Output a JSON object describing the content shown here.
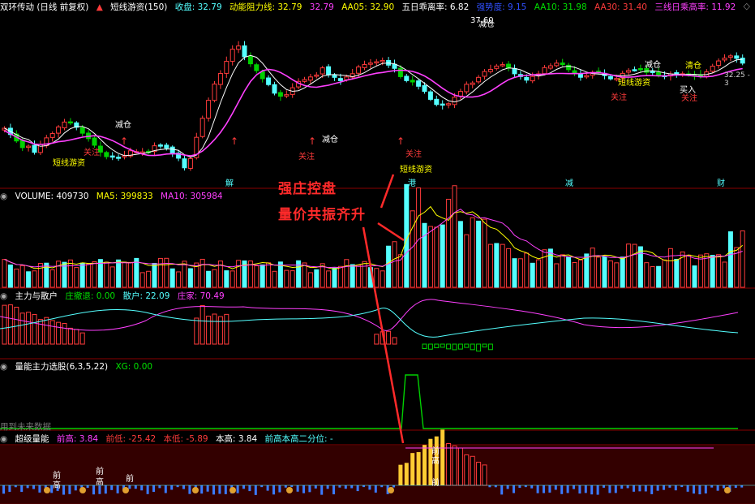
{
  "colors": {
    "up": "#ff3b3b",
    "down": "#54ffff",
    "green": "#00d000",
    "ma": "#ff40ff",
    "white": "#ffffff",
    "yellow": "#ffff00",
    "sep": "#8a0000"
  },
  "price_panel": {
    "title": "双环传动 (日线 前复权)",
    "indicator": "短线游资(150)",
    "close_label": "收盘: 32.79",
    "resist_label": "动能阻力线: 32.79",
    "v3": "32.79",
    "aa05": "AA05: 32.90",
    "five_day": "五日乖离率: 6.82",
    "hidden": "强势度: 9.15",
    "aa10": "AA10: 31.98",
    "aa30": "AA30: 31.40",
    "three": "三线日乘高率: 11.92",
    "high_label": "37.60",
    "right_label": "32.25 - 3"
  },
  "chart_labels": {
    "jian_cang": "减仓",
    "guan_zhu": "关注",
    "mai_ru": "买入",
    "qing_cang": "清仓",
    "xiao_you_zi": "短线游资",
    "jie": "解",
    "gang": "港",
    "jian": "减",
    "cai": "财"
  },
  "annotation": {
    "line1": "强庄控盘",
    "line2": "量价共振齐升"
  },
  "volume_panel": {
    "title": "VOLUME: 409730",
    "ma5": "MA5: 399833",
    "ma10": "MA10: 305984"
  },
  "zhuli_panel": {
    "title": "主力与散户",
    "zhuang_exit": "庄撤退: 0.00",
    "retail": "散户: 22.09",
    "zhuang": "庄家: 70.49"
  },
  "xuangu_panel": {
    "title": "量能主力选股(6,3,5,22)",
    "xg": "XG: 0.00",
    "footer": "用到未来数据"
  },
  "chaoji_panel": {
    "title": "超级量能",
    "qiangao": "前高: 3.84",
    "qiandi": "前低: -25.42",
    "bendi": "本低: -5.89",
    "bengao": "本高: 3.84",
    "quantile": "前高本高二分位: -"
  },
  "bottom_marks": {
    "qian": "前",
    "gao": "高"
  }
}
